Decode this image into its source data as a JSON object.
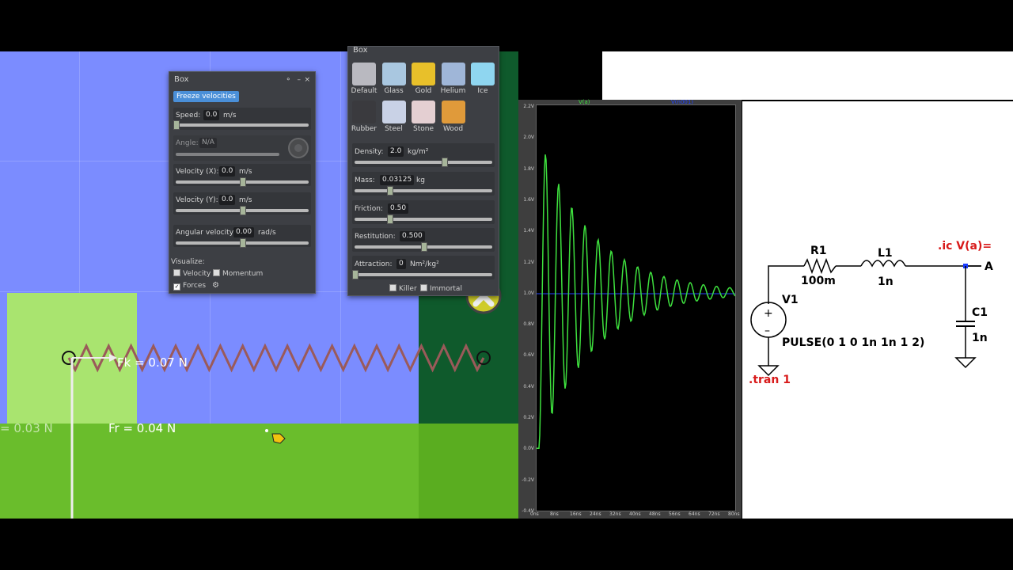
{
  "sim": {
    "fk_label": "Fk = 0.07 N",
    "fr_label": "Fr = 0.04 N",
    "f_left_label": "= 0.03 N",
    "colors": {
      "bg": "#7b8cff",
      "ground": "#6abd2c",
      "box": "#a9e46f",
      "spring": "#9a5a5a"
    }
  },
  "box_panel": {
    "title": "Box",
    "freeze_label": "Freeze velocities",
    "speed": {
      "label": "Speed:",
      "value": "0.0",
      "unit": "m/s",
      "slider": 0.0
    },
    "angle": {
      "label": "Angle:",
      "value": "N/A"
    },
    "vx": {
      "label": "Velocity (X):",
      "value": "0.0",
      "unit": "m/s",
      "slider": 0.5
    },
    "vy": {
      "label": "Velocity (Y):",
      "value": "0.0",
      "unit": "m/s",
      "slider": 0.5
    },
    "angvel": {
      "label": "Angular velocity:",
      "value": "0.00",
      "unit": "rad/s",
      "slider": 0.5
    },
    "visualize_label": "Visualize:",
    "velocity_label": "Velocity",
    "momentum_label": "Momentum",
    "forces_label": "Forces"
  },
  "material_panel": {
    "title": "Box",
    "materials": [
      {
        "name": "Default",
        "color": "#b9b9c0"
      },
      {
        "name": "Glass",
        "color": "#a9c7e0"
      },
      {
        "name": "Gold",
        "color": "#e8c02a"
      },
      {
        "name": "Helium",
        "color": "#9fb6d8"
      },
      {
        "name": "Ice",
        "color": "#8fd6f0"
      },
      {
        "name": "Rubber",
        "color": "#3a3a3e"
      },
      {
        "name": "Steel",
        "color": "#c9d2e6"
      },
      {
        "name": "Stone",
        "color": "#e4cfd2"
      },
      {
        "name": "Wood",
        "color": "#e09a3a"
      }
    ],
    "density": {
      "label": "Density:",
      "value": "2.0",
      "unit": "kg/m²",
      "slider": 0.65
    },
    "mass": {
      "label": "Mass:",
      "value": "0.03125",
      "unit": "kg",
      "slider": 0.25
    },
    "friction": {
      "label": "Friction:",
      "value": "0.50",
      "slider": 0.25
    },
    "restitution": {
      "label": "Restitution:",
      "value": "0.500",
      "slider": 0.5
    },
    "attraction": {
      "label": "Attraction:",
      "value": "0",
      "unit": "Nm²/kg²",
      "slider": 0.0
    },
    "killer_label": "Killer",
    "immortal_label": "Immortal"
  },
  "scope": {
    "trace_label": "V(a)",
    "trace2_label": "V(n001)",
    "y_ticks": [
      "2.2V",
      "2.0V",
      "1.8V",
      "1.6V",
      "1.4V",
      "1.2V",
      "1.0V",
      "0.8V",
      "0.6V",
      "0.4V",
      "0.2V",
      "0.0V",
      "-0.2V",
      "-0.4V"
    ],
    "x_ticks": [
      "0ns",
      "8ns",
      "16ns",
      "24ns",
      "32ns",
      "40ns",
      "48ns",
      "56ns",
      "64ns",
      "72ns",
      "80ns"
    ],
    "colors": {
      "trace": "#3ee03e",
      "trace2": "#2244ff",
      "bg": "#000000"
    }
  },
  "schematic": {
    "r1_name": "R1",
    "r1_value": "100m",
    "l1_name": "L1",
    "l1_value": "1n",
    "v1_name": "V1",
    "v1_value": "PULSE(0 1 0 1n 1n 1 2)",
    "c1_name": "C1",
    "c1_value": "1n",
    "ic_directive": ".ic V(a)=",
    "tran_directive": ".tran 1",
    "node_label": "A"
  }
}
